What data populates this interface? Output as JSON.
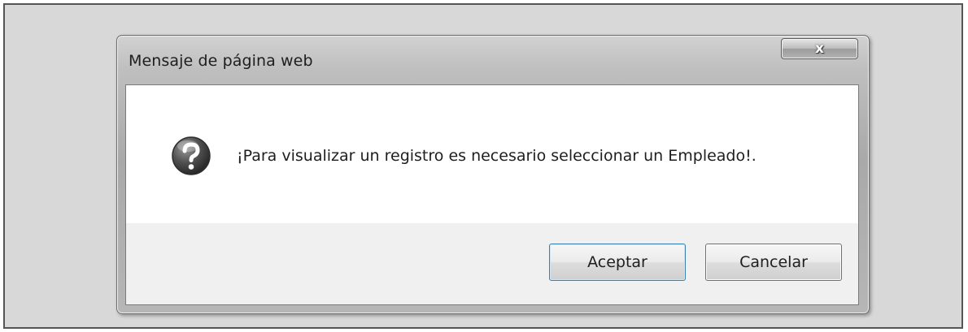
{
  "dialog": {
    "title": "Mensaje de página web",
    "close_glyph": "x",
    "close_icon": "close-icon",
    "message_icon": "question-icon",
    "message": "¡Para visualizar un registro es necesario seleccionar un Empleado!.",
    "buttons": {
      "accept_label": "Aceptar",
      "cancel_label": "Cancelar"
    }
  },
  "colors": {
    "page_background": "#d8d8d8",
    "message_background": "#ffffff",
    "button_panel_background": "#f0f0f0",
    "icon_fill": "#4a4a4a"
  }
}
